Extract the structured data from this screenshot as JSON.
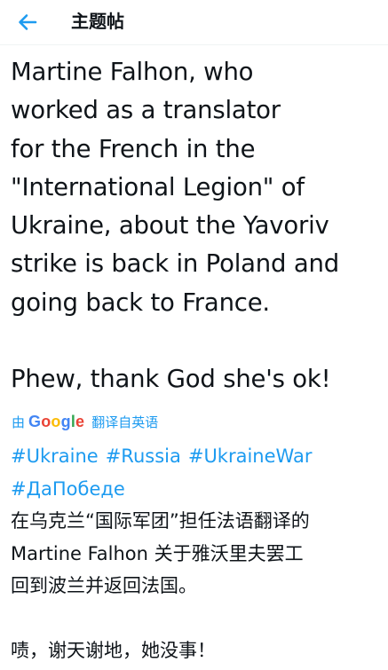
{
  "header": {
    "title": "主题帖",
    "back_icon": "arrow-left-icon",
    "accent": "#1d9bf0"
  },
  "tweet": {
    "lines": [
      "Martine Falhon, who",
      "worked as a translator",
      "for the French in the",
      "\"International Legion\" of",
      "Ukraine, about the Yavoriv",
      "strike is back in Poland and",
      "going back to France.",
      "Phew, thank God she's ok!"
    ]
  },
  "translate": {
    "by": "由",
    "provider": "Google",
    "link": "翻译自英语"
  },
  "translation": {
    "hashtags": [
      "#Ukraine",
      "#Russia",
      "#UkraineWar",
      "#ДаПобеде"
    ],
    "lines": [
      "在乌克兰“国际军团”担任法语翻译的",
      "Martine Falhon 关于雅沃里夫罢工",
      "回到波兰并返回法国。",
      "啧，谢天谢地，她没事！"
    ]
  }
}
